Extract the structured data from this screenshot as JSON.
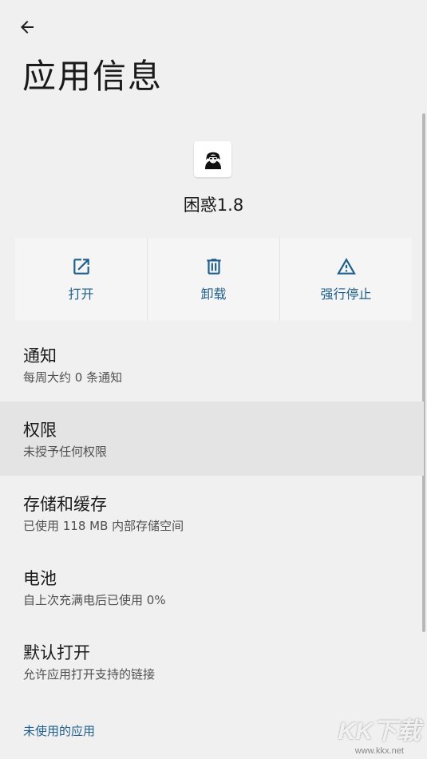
{
  "header": {
    "back_icon": "arrow-left-icon",
    "title": "应用信息"
  },
  "app": {
    "icon": "app-avatar-icon",
    "name": "困惑1.8"
  },
  "actions": [
    {
      "label": "打开",
      "icon": "open-external-icon"
    },
    {
      "label": "卸载",
      "icon": "trash-icon"
    },
    {
      "label": "强行停止",
      "icon": "warning-icon"
    }
  ],
  "settings": [
    {
      "title": "通知",
      "subtitle": "每周大约 0 条通知"
    },
    {
      "title": "权限",
      "subtitle": "未授予任何权限"
    },
    {
      "title": "存储和缓存",
      "subtitle": "已使用 118 MB 内部存储空间"
    },
    {
      "title": "电池",
      "subtitle": "自上次充满电后已使用 0%"
    },
    {
      "title": "默认打开",
      "subtitle": "允许应用打开支持的链接"
    }
  ],
  "unused_apps_link": "未使用的应用",
  "watermark": {
    "brand": "KK下载",
    "url": "www.kkx.net"
  },
  "colors": {
    "background": "#f0f0f0",
    "accent": "#1e5f8c",
    "highlight_row": "#e4e4e4"
  }
}
